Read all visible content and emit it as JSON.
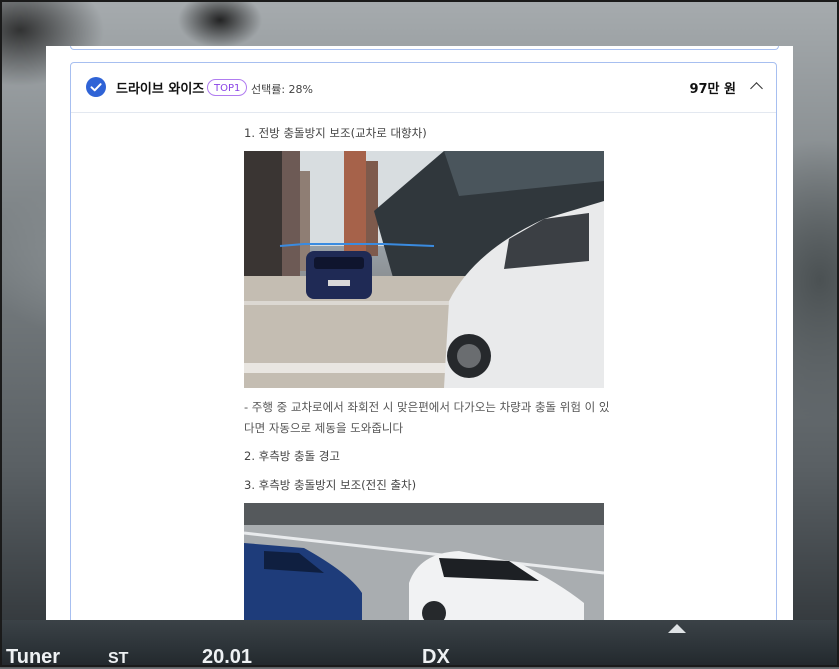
{
  "background": {
    "dash_labels": [
      "Tuner",
      "ST",
      "20.01",
      "DX"
    ]
  },
  "option": {
    "title": "드라이브 와이즈",
    "badge": "TOP1",
    "select_rate": "선택률: 28%",
    "price": "97만 원"
  },
  "features": {
    "item1_title": "1. 전방 충돌방지 보조(교차로 대향차)",
    "item1_desc": "- 주행 중 교차로에서 좌회전 시 맞은편에서 다가오는 차량과 충돌 위험 이 있다면 자동으로 제동을 도와줍니다",
    "item2_title": "2. 후측방 충돌 경고",
    "item3_title": "3. 후측방 충돌방지 보조(전진 출차)"
  },
  "colors": {
    "accent": "#2f63d6",
    "badge": "#8a43e6",
    "card_border": "#a7bff0"
  }
}
